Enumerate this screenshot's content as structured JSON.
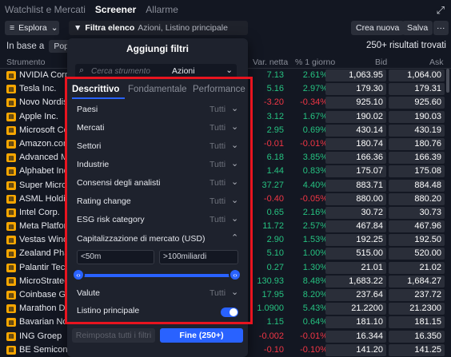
{
  "header": {
    "tabs": [
      "Watchlist e Mercati",
      "Screener",
      "Allarme"
    ],
    "active_tab": "Screener"
  },
  "toolbar": {
    "explore_label": "Esplora",
    "filter_label": "Filtra elenco",
    "filter_value": "Azioni, Listino principale",
    "new_label": "Crea nuova",
    "save_label": "Salva",
    "more_label": "···"
  },
  "subbar": {
    "based_on": "In base a",
    "chip": "Popol",
    "results": "250+ risultati trovati"
  },
  "columns": {
    "instrument": "Strumento",
    "net_change": "Var. netta",
    "pct_change": "% 1 giorno",
    "bid": "Bid",
    "ask": "Ask"
  },
  "rows": [
    {
      "name": "NVIDIA Corp",
      "chg": "7.13",
      "pct": "2.61%",
      "bid": "1,063.95",
      "ask": "1,064.00",
      "dir": "pos"
    },
    {
      "name": "Tesla Inc.",
      "chg": "5.16",
      "pct": "2.97%",
      "bid": "179.30",
      "ask": "179.31",
      "dir": "pos"
    },
    {
      "name": "Novo Nordis",
      "chg": "-3.20",
      "pct": "-0.34%",
      "bid": "925.10",
      "ask": "925.60",
      "dir": "neg"
    },
    {
      "name": "Apple Inc.",
      "chg": "3.12",
      "pct": "1.67%",
      "bid": "190.02",
      "ask": "190.03",
      "dir": "pos"
    },
    {
      "name": "Microsoft Co",
      "chg": "2.95",
      "pct": "0.69%",
      "bid": "430.14",
      "ask": "430.19",
      "dir": "pos"
    },
    {
      "name": "Amazon.con",
      "chg": "-0.01",
      "pct": "-0.01%",
      "bid": "180.74",
      "ask": "180.76",
      "dir": "neg"
    },
    {
      "name": "Advanced M",
      "chg": "6.18",
      "pct": "3.85%",
      "bid": "166.36",
      "ask": "166.39",
      "dir": "pos"
    },
    {
      "name": "Alphabet Inc",
      "chg": "1.44",
      "pct": "0.83%",
      "bid": "175.07",
      "ask": "175.08",
      "dir": "pos"
    },
    {
      "name": "Super Micro",
      "chg": "37.27",
      "pct": "4.40%",
      "bid": "883.71",
      "ask": "884.48",
      "dir": "pos"
    },
    {
      "name": "ASML Holdi",
      "chg": "-0.40",
      "pct": "-0.05%",
      "bid": "880.00",
      "ask": "880.20",
      "dir": "neg"
    },
    {
      "name": "Intel Corp.",
      "chg": "0.65",
      "pct": "2.16%",
      "bid": "30.72",
      "ask": "30.73",
      "dir": "pos"
    },
    {
      "name": "Meta Platfor",
      "chg": "11.72",
      "pct": "2.57%",
      "bid": "467.84",
      "ask": "467.96",
      "dir": "pos"
    },
    {
      "name": "Vestas Wind",
      "chg": "2.90",
      "pct": "1.53%",
      "bid": "192.25",
      "ask": "192.50",
      "dir": "pos"
    },
    {
      "name": "Zealand Pha",
      "chg": "5.10",
      "pct": "1.00%",
      "bid": "515.00",
      "ask": "520.00",
      "dir": "pos"
    },
    {
      "name": "Palantir Tec",
      "chg": "0.27",
      "pct": "1.30%",
      "bid": "21.01",
      "ask": "21.02",
      "dir": "pos"
    },
    {
      "name": "MicroStrateg",
      "chg": "130.93",
      "pct": "8.48%",
      "bid": "1,683.22",
      "ask": "1,684.27",
      "dir": "pos"
    },
    {
      "name": "Coinbase Gl",
      "chg": "17.95",
      "pct": "8.20%",
      "bid": "237.64",
      "ask": "237.72",
      "dir": "pos"
    },
    {
      "name": "Marathon Di",
      "chg": "1.0900",
      "pct": "5.43%",
      "bid": "21.2200",
      "ask": "21.2300",
      "dir": "pos"
    },
    {
      "name": "Bavarian No",
      "chg": "1.15",
      "pct": "0.64%",
      "bid": "181.10",
      "ask": "181.15",
      "dir": "pos"
    },
    {
      "name": "ING Groep",
      "chg": "-0.002",
      "pct": "-0.01%",
      "bid": "16.344",
      "ask": "16.350",
      "dir": "neg"
    },
    {
      "name": "BE Semicon",
      "chg": "-0.10",
      "pct": "-0.10%",
      "bid": "141.20",
      "ask": "141.25",
      "dir": "neg"
    }
  ],
  "modal": {
    "title": "Aggiungi filtri",
    "search_placeholder": "Cerca strumento",
    "type_select": "Azioni",
    "tabs": [
      "Descrittivo",
      "Fondamentale",
      "Performance"
    ],
    "active_tab": "Descrittivo",
    "filters": [
      {
        "label": "Paesi",
        "value": "Tutti"
      },
      {
        "label": "Mercati",
        "value": "Tutti"
      },
      {
        "label": "Settori",
        "value": "Tutti"
      },
      {
        "label": "Industrie",
        "value": "Tutti"
      },
      {
        "label": "Consensi degli analisti",
        "value": "Tutti"
      },
      {
        "label": "Rating change",
        "value": "Tutti"
      },
      {
        "label": "ESG risk category",
        "value": "Tutti"
      }
    ],
    "market_cap_label": "Capitalizzazione di mercato (USD)",
    "range_min": "<50m",
    "range_max": ">100miliardi",
    "valute_label": "Valute",
    "valute_value": "Tutti",
    "listino_label": "Listino principale",
    "listino_on": true,
    "reset_label": "Reimposta tutti i filtri",
    "done_label": "Fine (250+)"
  },
  "colors": {
    "accent": "#2962ff",
    "positive": "#26c281",
    "negative": "#f23645",
    "highlight_box": "#e8141f"
  }
}
